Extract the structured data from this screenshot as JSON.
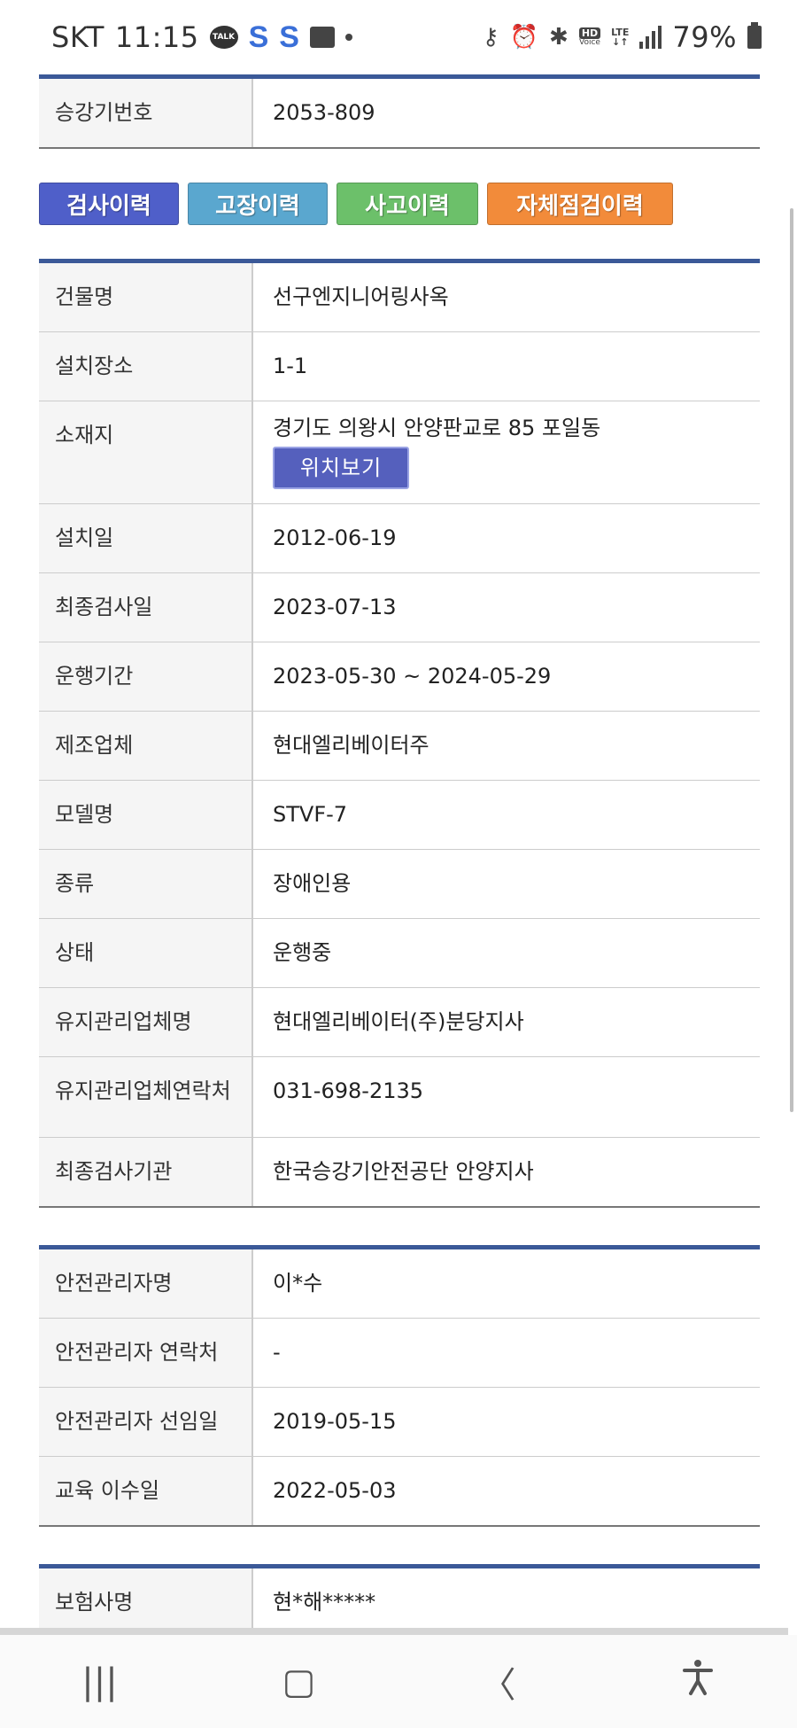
{
  "status_bar": {
    "carrier": "SKT",
    "time": "11:15",
    "talk_label": "TALK",
    "s_app_1": "S",
    "s_app_2": "S",
    "hd_label": "HD",
    "voice_label": "Voice",
    "lte_label": "LTE",
    "battery_pct": "79%"
  },
  "top_table": {
    "rows": [
      {
        "label": "승강기번호",
        "value": "2053-809"
      }
    ]
  },
  "history_buttons": [
    {
      "label": "검사이력",
      "color": "#4f5fc9"
    },
    {
      "label": "고장이력",
      "color": "#5aa7cf"
    },
    {
      "label": "사고이력",
      "color": "#6cc06a"
    },
    {
      "label": "자체점검이력",
      "color": "#f28b3a"
    }
  ],
  "info_table": {
    "building_label": "건물명",
    "building_value": "선구엔지니어링사옥",
    "place_label": "설치장소",
    "place_value": "1-1",
    "address_label": "소재지",
    "address_value": "경기도 의왕시 안양판교로 85 포일동",
    "location_button": "위치보기",
    "install_label": "설치일",
    "install_value": "2012-06-19",
    "last_inspect_label": "최종검사일",
    "last_inspect_value": "2023-07-13",
    "period_label": "운행기간",
    "period_value": "2023-05-30 ~ 2024-05-29",
    "maker_label": "제조업체",
    "maker_value": "현대엘리베이터주",
    "model_label": "모델명",
    "model_value": "STVF-7",
    "type_label": "종류",
    "type_value": "장애인용",
    "state_label": "상태",
    "state_value": "운행중",
    "maint_label": "유지관리업체명",
    "maint_value": "현대엘리베이터(주)분당지사",
    "maint_contact_label": "유지관리업체연락처",
    "maint_contact_value": "031-698-2135",
    "inspect_org_label": "최종검사기관",
    "inspect_org_value": "한국승강기안전공단 안양지사"
  },
  "safety_table": {
    "rows": [
      {
        "label": "안전관리자명",
        "value": "이*수"
      },
      {
        "label": "안전관리자 연락처",
        "value": "-"
      },
      {
        "label": "안전관리자 선임일",
        "value": "2019-05-15"
      },
      {
        "label": "교육 이수일",
        "value": "2022-05-03"
      }
    ]
  },
  "insurance_table": {
    "rows": [
      {
        "label": "보험사명",
        "value": "현*해*****"
      }
    ]
  },
  "nav": {
    "recent": "|||",
    "home": "▢",
    "back": "〈",
    "accessibility": "accessibility-icon"
  }
}
